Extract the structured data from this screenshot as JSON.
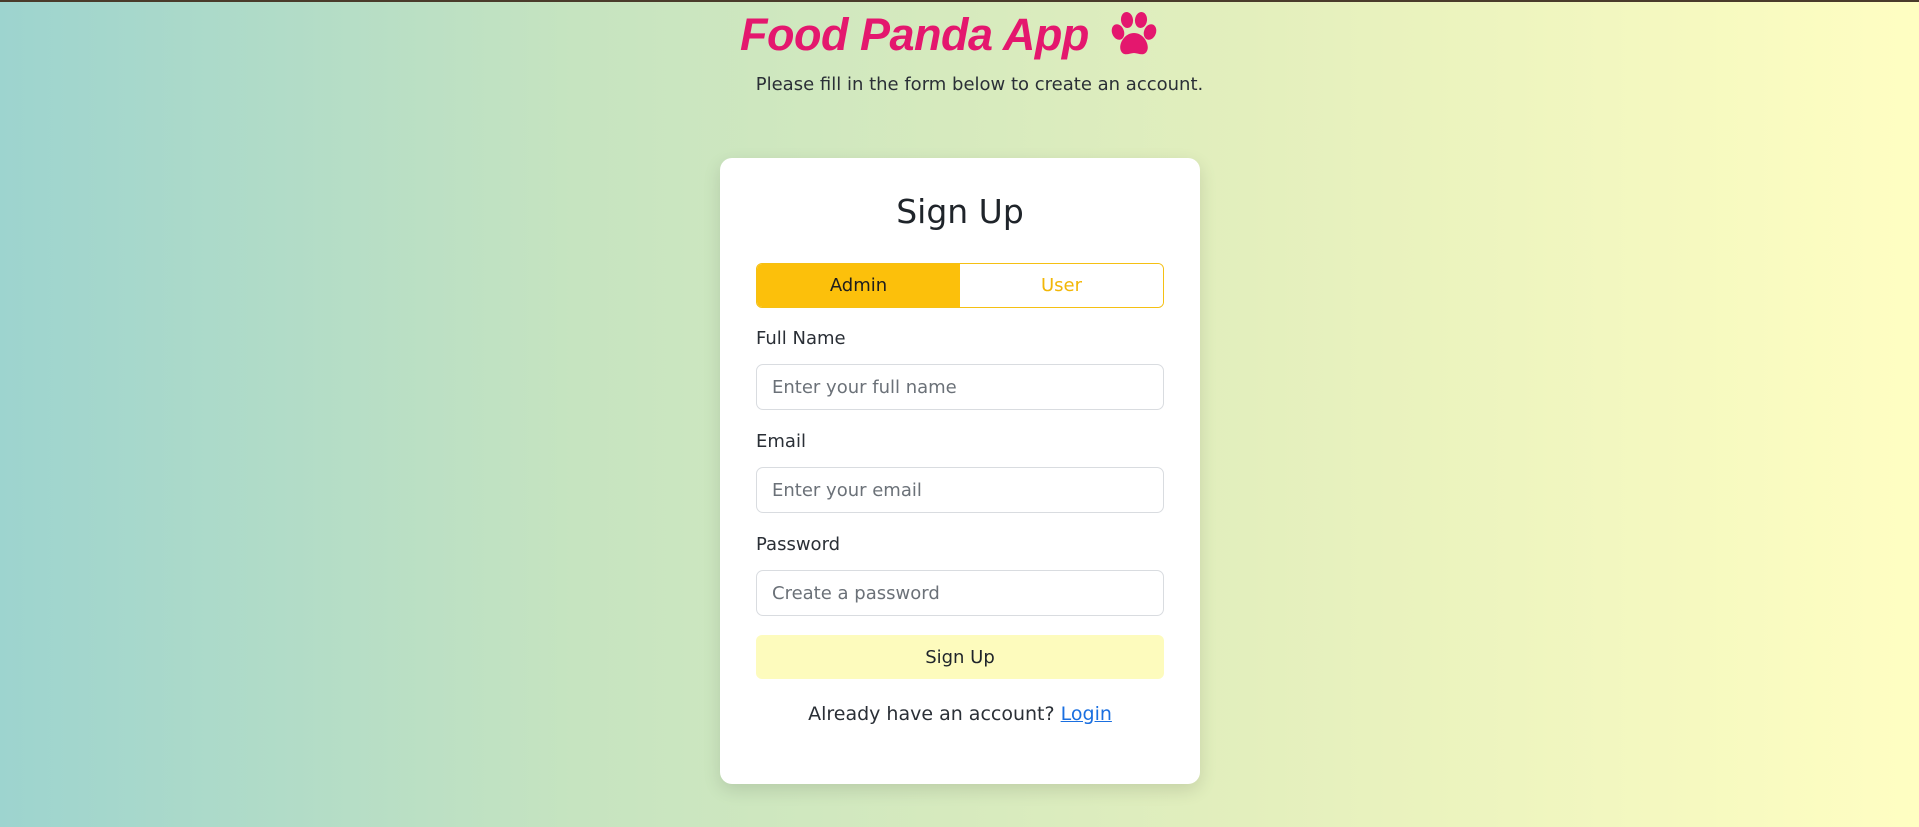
{
  "header": {
    "title": "Food Panda App",
    "icon": "paw-icon",
    "subtitle": "Please fill in the form below to create an account."
  },
  "form": {
    "title": "Sign Up",
    "roles": {
      "admin_label": "Admin",
      "user_label": "User",
      "selected": "Admin"
    },
    "full_name": {
      "label": "Full Name",
      "placeholder": "Enter your full name",
      "value": ""
    },
    "email": {
      "label": "Email",
      "placeholder": "Enter your email",
      "value": ""
    },
    "password": {
      "label": "Password",
      "placeholder": "Create a password",
      "value": ""
    },
    "submit_label": "Sign Up",
    "login_prompt": "Already have an account?",
    "login_link": "Login"
  },
  "colors": {
    "brand": "#e4176e",
    "accent": "#fcc00b",
    "link": "#1a6fe0",
    "submit_bg": "#fdfbbd"
  }
}
